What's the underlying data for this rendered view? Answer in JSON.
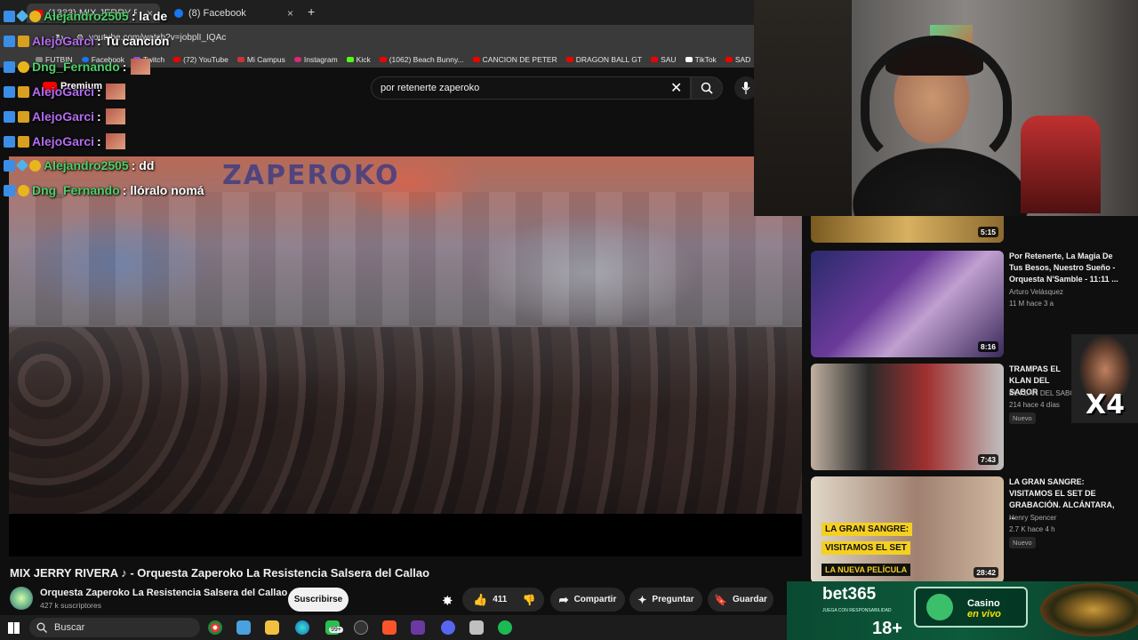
{
  "browser": {
    "tabs": [
      {
        "label": "(1323) MIX JERRY RIVERA",
        "active": true
      },
      {
        "label": "(8) Facebook",
        "active": false
      }
    ],
    "url": "youtube.com/watch?v=jobplI_IQAc",
    "bookmarks": [
      "FUTBIN",
      "Facebook",
      "Twitch",
      "(72) YouTube",
      "Mi Campus",
      "Instagram",
      "Kick",
      "(1062) Beach Bunny...",
      "CANCION DE PETER",
      "DRAGON BALL GT",
      "SAU",
      "TikTok",
      "SAD"
    ]
  },
  "youtube": {
    "logo_text": "Premium",
    "search_query": "por retenerte zaperoko",
    "video_title": "MIX JERRY RIVERA ♪ - Orquesta Zaperoko La Resistencia Salsera del Callao",
    "channel_name": "Orquesta Zaperoko La Resistencia Salsera del Callao",
    "subscribers": "427 k suscriptores",
    "subscribe_label": "Suscribirse",
    "likes": "411",
    "share_label": "Compartir",
    "ask_label": "Preguntar",
    "save_label": "Guardar",
    "mural_text": "ZAPEROKO"
  },
  "chat": [
    {
      "user": "Alejandro2505",
      "text": ": la de",
      "color": "green"
    },
    {
      "user": "AlejoGarci",
      "text": ": Tu canción",
      "color": "purple"
    },
    {
      "user": "Dng_Fernando",
      "text": ":",
      "color": "green",
      "emote": true
    },
    {
      "user": "AlejoGarci",
      "text": ":",
      "color": "purple",
      "emote": true
    },
    {
      "user": "AlejoGarci",
      "text": ":",
      "color": "purple",
      "emote": true
    },
    {
      "user": "AlejoGarci",
      "text": ":",
      "color": "purple",
      "emote": true
    },
    {
      "user": "Alejandro2505",
      "text": ": dd",
      "color": "green"
    },
    {
      "user": "Dng_Fernando",
      "text": ": llóralo nomá",
      "color": "green"
    }
  ],
  "sidebar": {
    "first_duration": "5:15",
    "videos": [
      {
        "title": "Por Retenerte, La Magia De Tus Besos, Nuestro Sueño - Orquesta N'Samble - 11:11 ...",
        "channel": "Arturo Velásquez",
        "meta": "11 M  hace 3 a",
        "duration": "8:16",
        "new": ""
      },
      {
        "title": "TRAMPAS EL KLAN DEL SABOR",
        "channel": "EL KLAN DEL SABOR",
        "meta": "214  hace 4 días",
        "duration": "7:43",
        "new": "Nuevo"
      },
      {
        "title": "LA GRAN SANGRE: VISITAMOS EL SET DE GRABACIÓN. ALCÁNTARA, ...",
        "channel": "Henry Spencer",
        "meta": "2.7 K  hace 4 h",
        "duration": "28:42",
        "new": "Nuevo",
        "thumb_text": [
          "LA GRAN SANGRE:",
          "VISITAMOS EL SET",
          "LA NUEVA PELÍCULA"
        ]
      }
    ]
  },
  "overlay": {
    "x4_label": "X4"
  },
  "banner": {
    "brand": "bet365",
    "small_print": "JUEGA CON RESPONSABILIDAD",
    "age": "18+",
    "casino_line1": "Casino",
    "casino_line2": "en vivo"
  },
  "taskbar": {
    "search_label": "Buscar",
    "badge": "99+"
  }
}
